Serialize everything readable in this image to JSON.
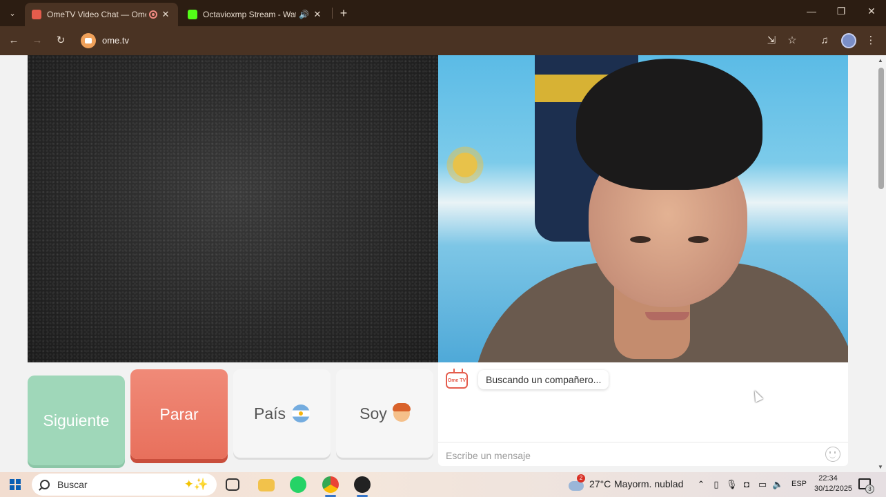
{
  "browser": {
    "tabs": [
      {
        "title": "OmeTV Video Chat — OmeTV: Chatea con desconocidos",
        "active": true,
        "recording": true
      },
      {
        "title": "Octavioxmp Stream - Watch Live on Kick",
        "active": false,
        "audio": true
      }
    ],
    "new_tab_label": "+",
    "url": "ome.tv",
    "colors": {
      "tab_bar": "#2c1d12",
      "toolbar": "#4a3323"
    }
  },
  "page": {
    "controls": {
      "next_label": "Siguiente",
      "stop_label": "Parar",
      "country_label": "País",
      "country_icon": "argentina-flag-icon",
      "soy_label": "Soy",
      "soy_icon": "boy-emoji-icon"
    },
    "chat": {
      "status_message": "Buscando un compañero...",
      "input_placeholder": "Escribe un mensaje",
      "logo_text": "Ome TV"
    },
    "colors": {
      "next": "#9fd7b9",
      "stop": "#e8705c",
      "accent": "#e45c4c"
    }
  },
  "taskbar": {
    "search_label": "Buscar",
    "weather_temp": "27°C",
    "weather_desc": "Mayorm. nublado",
    "weather_badge": "2",
    "language": "ESP",
    "time": "22:34",
    "date": "30/12/2025",
    "notification_count": "3"
  }
}
